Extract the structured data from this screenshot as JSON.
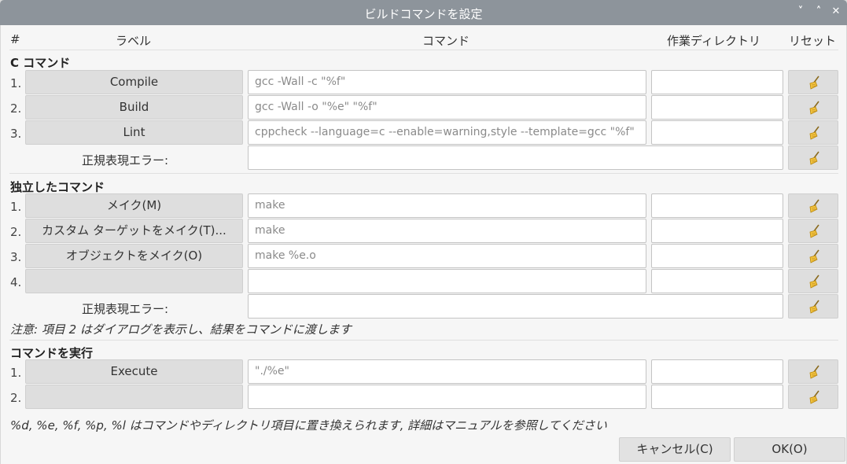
{
  "window": {
    "title": "ビルドコマンドを設定",
    "controls": [
      "˅",
      "˄",
      "✕"
    ]
  },
  "header": {
    "num": "#",
    "label": "ラベル",
    "command": "コマンド",
    "workdir": "作業ディレクトリ",
    "reset": "リセット"
  },
  "sections": {
    "c": {
      "title": "C コマンド",
      "rows": [
        {
          "num": "1.",
          "label": "Compile",
          "command": "gcc -Wall -c \"%f\"",
          "dir": ""
        },
        {
          "num": "2.",
          "label": "Build",
          "command": "gcc -Wall -o \"%e\" \"%f\"",
          "dir": ""
        },
        {
          "num": "3.",
          "label": "Lint",
          "command": "cppcheck --language=c --enable=warning,style --template=gcc \"%f\"",
          "dir": ""
        }
      ],
      "regex_label": "正規表現エラー:",
      "regex_value": ""
    },
    "independent": {
      "title": "独立したコマンド",
      "rows": [
        {
          "num": "1.",
          "label": "メイク(M)",
          "command": "make",
          "dir": ""
        },
        {
          "num": "2.",
          "label": "カスタム ターゲットをメイク(T)...",
          "command": "make",
          "dir": ""
        },
        {
          "num": "3.",
          "label": "オブジェクトをメイク(O)",
          "command": "make %e.o",
          "dir": ""
        },
        {
          "num": "4.",
          "label": "",
          "command": "",
          "dir": ""
        }
      ],
      "regex_label": "正規表現エラー:",
      "regex_value": "",
      "note": "注意: 項目 2 はダイアログを表示し、結果をコマンドに渡します"
    },
    "execute": {
      "title": "コマンドを実行",
      "rows": [
        {
          "num": "1.",
          "label": "Execute",
          "command": "\"./%e\"",
          "dir": ""
        },
        {
          "num": "2.",
          "label": "",
          "command": "",
          "dir": ""
        }
      ]
    }
  },
  "footer": {
    "note": "%d, %e, %f, %p, %l はコマンドやディレクトリ項目に置き換えられます, 詳細はマニュアルを参照してください",
    "cancel": "キャンセル(C)",
    "ok": "OK(O)"
  },
  "icons": {
    "reset": "broom-icon"
  }
}
